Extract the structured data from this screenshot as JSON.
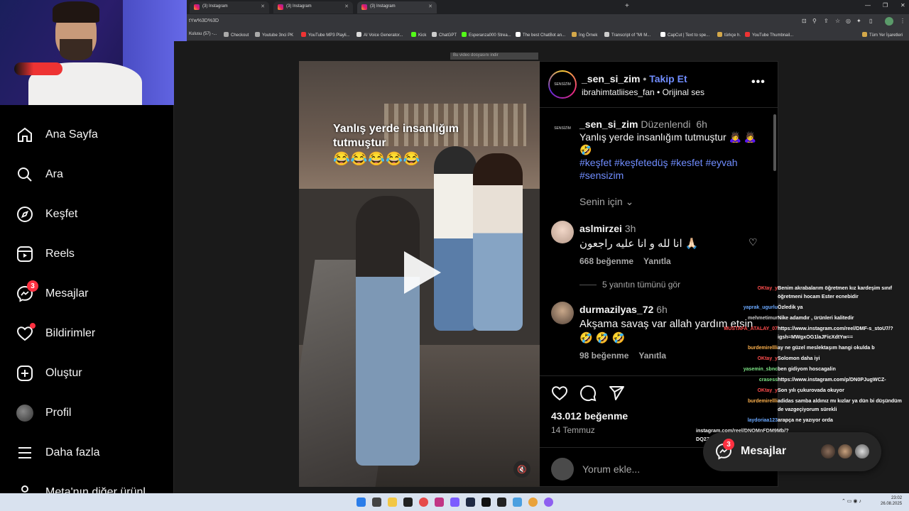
{
  "browser": {
    "tabs": [
      {
        "title": "(3) Instagram"
      },
      {
        "title": "(3) Instagram"
      },
      {
        "title": "(3) Instagram"
      }
    ],
    "url": "tYw%3D%3D",
    "bookmarks": [
      "Kulusu (57) -...",
      "Checkout",
      "Youtube 3nci PK",
      "YouTube MP3 Playli...",
      "AI Voice Generator...",
      "Kick",
      "ChatGPT",
      "Esperanza000 Strea...",
      "The best ChatBot an...",
      "İng Örnek",
      "Transcript of \"MI M...",
      "CapCut | Text to spe...",
      "türkçe h.",
      "YouTube Thumbnail...",
      "Tüm Yer İşaretleri"
    ]
  },
  "tooltip": "Bu video dosyasını indir",
  "sidebar": {
    "items": [
      {
        "label": "Ana Sayfa",
        "icon": "home-icon"
      },
      {
        "label": "Ara",
        "icon": "search-icon"
      },
      {
        "label": "Keşfet",
        "icon": "compass-icon"
      },
      {
        "label": "Reels",
        "icon": "reels-icon"
      },
      {
        "label": "Mesajlar",
        "icon": "messenger-icon",
        "badge": "3"
      },
      {
        "label": "Bildirimler",
        "icon": "heart-icon",
        "dot": true
      },
      {
        "label": "Oluştur",
        "icon": "plus-square-icon"
      },
      {
        "label": "Profil",
        "icon": "profile-avatar"
      },
      {
        "label": "Daha fazla",
        "icon": "menu-icon"
      },
      {
        "label": "Meta'nın diğer ürünl",
        "icon": "meta-icon"
      }
    ]
  },
  "video": {
    "caption_line1": "Yanlış yerde insanlığım",
    "caption_line2": "tutmuştur",
    "emojis": "😂😂😂😂😂"
  },
  "post": {
    "author": "_sen_si_zim",
    "separator": " • ",
    "follow_label": "Takip Et",
    "audio_author": "ibrahimtatliises_fan",
    "audio_label": "Orijinal ses",
    "avatar_text": "SENSİZİM",
    "caption": {
      "author": "_sen_si_zim",
      "edited": "Düzenlendi",
      "time": "6h",
      "text": "Yanlış yerde insanlığım tutmuştur 🙇‍♀️ 🙇‍♀️ 🤣",
      "hashtags": "#keşfet #keşfetedüş #kesfet #eyvah #sensizim"
    },
    "for_you_label": "Senin için",
    "comments": [
      {
        "user": "aslmirzei",
        "time": "3h",
        "text": "انا لله و انا عليه راجعون 🙏🏻",
        "likes": "668 beğenme",
        "reply": "Yanıtla",
        "view_replies": "5 yanıtın tümünü gör"
      },
      {
        "user": "durmazilyas_72",
        "time": "6h",
        "text": "Akşama savaş var allah yardım etsin 🤣 🤣 🤣",
        "likes": "98 beğenme",
        "reply": "Yanıtla"
      }
    ],
    "like_count": "43.012 beğenme",
    "date": "14 Temmuz",
    "comment_placeholder": "Yorum ekle..."
  },
  "chat": [
    {
      "user": "OKtay_y",
      "msg": "Benim akrabalarım öğretmen kız kardeşim sınıf öğretmeni hocam Ester ecnebidir",
      "color": "#ff4d4d"
    },
    {
      "user": "yaprak_ugurlu",
      "msg": "Özledik ya",
      "color": "#6aa8ff"
    },
    {
      "user": "mehmetimur",
      "msg": "Nike adamdır , ürünleri kalitedir",
      "color": "#cccccc"
    },
    {
      "user": "MUSTAFA_ATALAY_07",
      "msg": "https://www.instagram.com/reel/DMF-s_stoU7/?igsh=MWgxOG1laJFicXdtYw==",
      "color": "#ff4d4d"
    },
    {
      "user": "burdemirellli",
      "msg": "ay ne güzel meslektaşım hangi okulda b",
      "color": "#ffb24d"
    },
    {
      "user": "OKtay_y",
      "msg": "Solomon daha iyi",
      "color": "#ff4d4d"
    },
    {
      "user": "yasemin_sbnc",
      "msg": "ben gidiyom hoscagalin",
      "color": "#7ee787"
    },
    {
      "user": "crasess",
      "msg": "https://www.instagram.com/p/DN0PJugWCZ-",
      "color": "#7ee787"
    },
    {
      "user": "OKtay_y",
      "msg": "Son yılı çukurovada okuyor",
      "color": "#ff4d4d"
    },
    {
      "user": "burdemirellli",
      "msg": "adidas samba aldınız mı kızlar ya dün bi düşündüm de vazgeçiyorum sürekli",
      "color": "#ffb24d"
    },
    {
      "user": "laydoriaa123",
      "msg": "arapça ne yazıyor orda",
      "color": "#6aa8ff"
    },
    {
      "user": "",
      "msg": "instagram.com/reel/DNOMnFDM9Mb/?",
      "color": "#ffffff"
    },
    {
      "user": "",
      "msg": "DQ2ZG0zbXc1",
      "color": "#ffffff"
    }
  ],
  "messages_pill": {
    "label": "Mesajlar",
    "badge": "3"
  },
  "taskbar": {
    "time": "23:02",
    "date": "26.08.2025"
  },
  "colors": {
    "accent": "#708dff",
    "badge": "#ff3040",
    "panel": "#000000",
    "chrome": "#35363a"
  }
}
